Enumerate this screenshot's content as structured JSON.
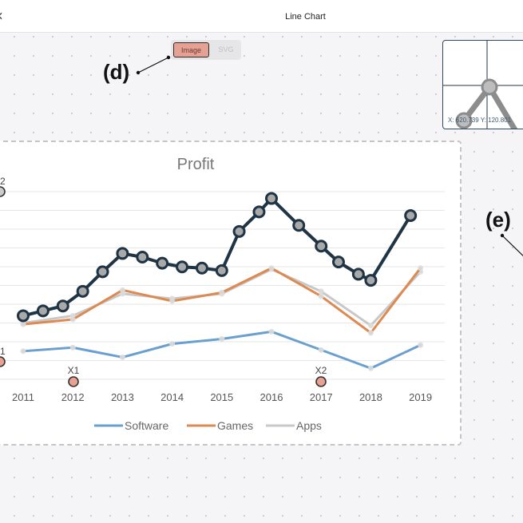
{
  "app": {
    "title": "Line Chart"
  },
  "toggle": {
    "image_label": "Image",
    "svg_label": "SVG",
    "selected": "Image"
  },
  "callouts": {
    "d": "(d)",
    "e": "(e)"
  },
  "minimap": {
    "x_readout": "X: 620.739",
    "y_readout": "Y: 120.801"
  },
  "markers": {
    "top_left": "2",
    "mid_left": "1",
    "x1": "X1",
    "x2": "X2"
  },
  "colors": {
    "software": "#6b9fcf",
    "games": "#dd8a52",
    "apps": "#c8c8c8",
    "profit": "#1f3444",
    "marker_fill": "#e8a294",
    "grid": "#e6e6e6"
  },
  "chart_data": {
    "type": "line",
    "title": "Profit",
    "categories": [
      "2011",
      "2012",
      "2013",
      "2014",
      "2015",
      "2016",
      "2017",
      "2018",
      "2019"
    ],
    "x": [
      "2011",
      "2012",
      "2013",
      "2014",
      "2015",
      "2016",
      "2017",
      "2018",
      "2019"
    ],
    "ylim": [
      0,
      10
    ],
    "grid": true,
    "legend": "bottom",
    "series": [
      {
        "name": "Software",
        "color_key": "software",
        "values": [
          2.3,
          2.6,
          1.8,
          2.9,
          3.3,
          3.9,
          2.4,
          0.9,
          2.8
        ]
      },
      {
        "name": "Games",
        "color_key": "games",
        "values": [
          4.5,
          4.9,
          7.3,
          6.4,
          7.1,
          9.1,
          6.8,
          3.8,
          9.1
        ]
      },
      {
        "name": "Apps",
        "color_key": "apps",
        "values": [
          4.6,
          5.2,
          7.0,
          6.6,
          7.0,
          9.0,
          7.2,
          4.4,
          8.8
        ]
      },
      {
        "name": "",
        "color_key": "profit",
        "x": [
          2011,
          2011.4,
          2011.8,
          2012.2,
          2012.6,
          2013,
          2013.4,
          2013.8,
          2014.2,
          2014.6,
          2015,
          2015.35,
          2015.75,
          2016,
          2016.55,
          2017,
          2017.35,
          2017.75,
          2018,
          2018.8
        ],
        "values": [
          5.2,
          5.6,
          6.0,
          7.2,
          8.8,
          10.3,
          10.0,
          9.5,
          9.2,
          9.1,
          8.9,
          12.1,
          13.7,
          14.8,
          12.6,
          10.9,
          9.6,
          8.6,
          8.1,
          13.4
        ]
      }
    ]
  }
}
